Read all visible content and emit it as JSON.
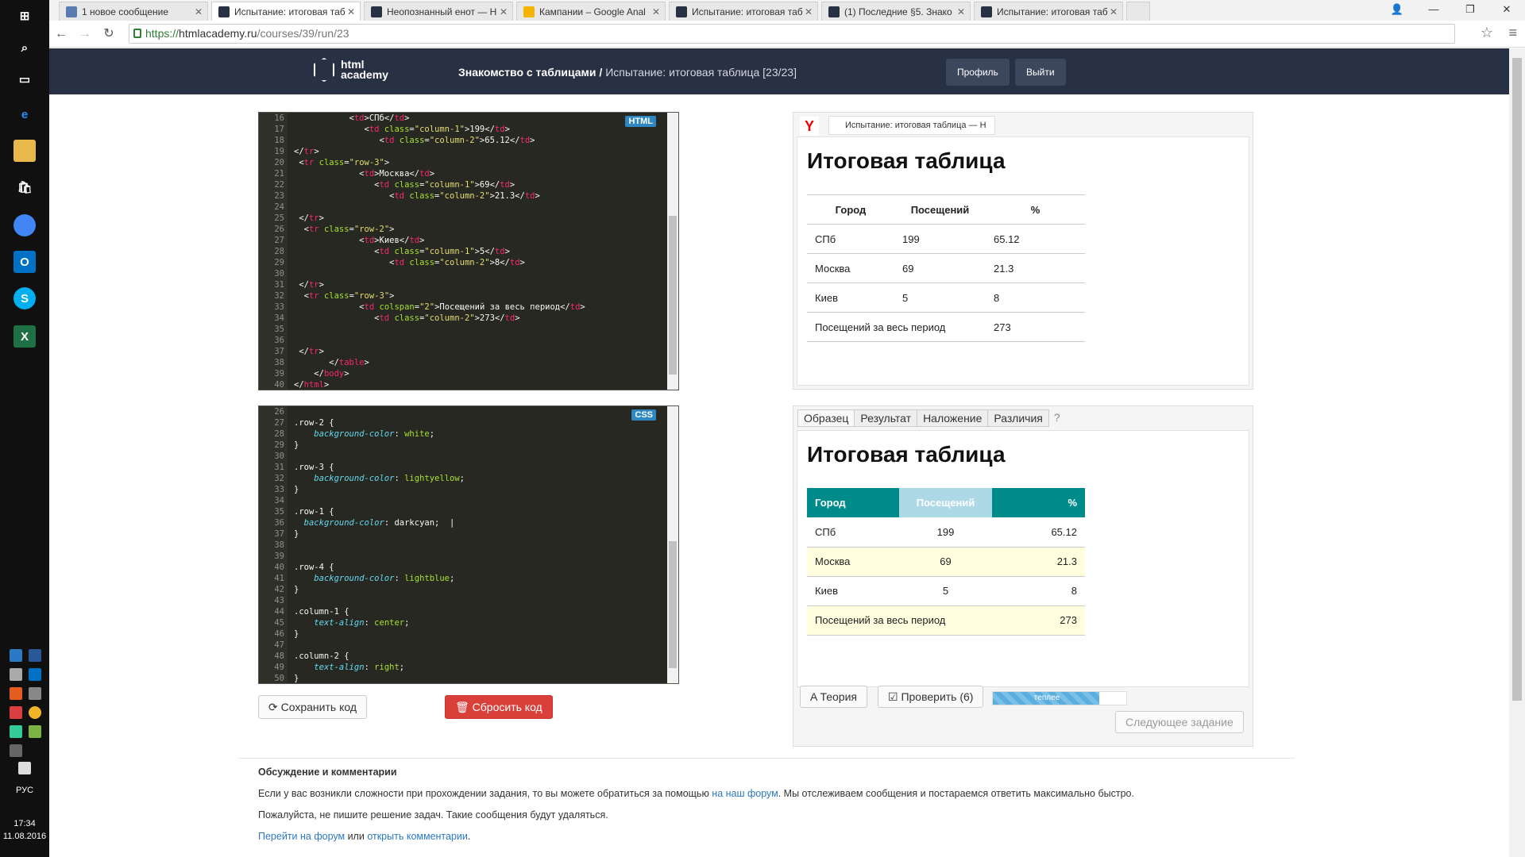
{
  "taskbar": {
    "language": "РУС",
    "time": "17:34",
    "date": "11.08.2016"
  },
  "tabs": [
    {
      "label": "1 новое сообщение",
      "icon_color": "#5b7bb3",
      "active": false
    },
    {
      "label": "Испытание: итоговая таб",
      "icon_color": "#283043",
      "active": true
    },
    {
      "label": "Неопознанный енот — H",
      "icon_color": "#283043",
      "active": false
    },
    {
      "label": "Кампании – Google Anal",
      "icon_color": "#f4b400",
      "active": false
    },
    {
      "label": "Испытание: итоговая таб",
      "icon_color": "#283043",
      "active": false
    },
    {
      "label": "(1) Последние §5. Знако",
      "icon_color": "#283043",
      "active": false
    },
    {
      "label": "Испытание: итоговая таб",
      "icon_color": "#283043",
      "active": false
    }
  ],
  "url": {
    "protocol": "https://",
    "host": "htmlacademy.ru",
    "path": "/courses/39/run/23"
  },
  "header": {
    "logo_line1": "html",
    "logo_line2": "academy",
    "course": "Знакомство с таблицами",
    "separator": " / ",
    "lesson": "Испытание: итоговая таблица",
    "progress": "[23/23]",
    "profile_btn": "Профиль",
    "logout_btn": "Выйти"
  },
  "html_editor": {
    "badge": "HTML",
    "line_numbers": [
      "16",
      "17",
      "18",
      "19",
      "20",
      "21",
      "22",
      "23",
      "24",
      "25",
      "26",
      "27",
      "28",
      "29",
      "30",
      "31",
      "32",
      "33",
      "34",
      "35",
      "36",
      "37",
      "38",
      "39",
      "40"
    ]
  },
  "css_editor": {
    "badge": "CSS",
    "line_numbers": [
      "26",
      "27",
      "28",
      "29",
      "30",
      "31",
      "32",
      "33",
      "34",
      "35",
      "36",
      "37",
      "38",
      "39",
      "40",
      "41",
      "42",
      "43",
      "44",
      "45",
      "46",
      "47",
      "48",
      "49",
      "50"
    ]
  },
  "buttons": {
    "save": "Сохранить код",
    "reset": "Сбросить код",
    "theory": "Теория",
    "check": "Проверить (6)",
    "next": "Следующее задание"
  },
  "result_preview": {
    "browser_tab": "Испытание: итоговая таблица — Н",
    "heading": "Итоговая таблица",
    "columns": [
      "Город",
      "Посещений",
      "%"
    ],
    "rows": [
      [
        "СПб",
        "199",
        "65.12"
      ],
      [
        "Москва",
        "69",
        "21.3"
      ],
      [
        "Киев",
        "5",
        "8"
      ]
    ],
    "total_label": "Посещений за весь период",
    "total_value": "273"
  },
  "sample_preview": {
    "tabs": [
      "Образец",
      "Результат",
      "Наложение",
      "Различия",
      "?"
    ],
    "heading": "Итоговая таблица",
    "columns": [
      "Город",
      "Посещений",
      "%"
    ],
    "rows": [
      [
        "СПб",
        "199",
        "65.12"
      ],
      [
        "Москва",
        "69",
        "21.3"
      ],
      [
        "Киев",
        "5",
        "8"
      ]
    ],
    "total_label": "Посещений за весь период",
    "total_value": "273",
    "colors": {
      "header": "#008b8b",
      "header_highlight": "#add8e6",
      "row_highlight": "#ffffe0"
    }
  },
  "hint": {
    "label": "теплее",
    "level": 0.8
  },
  "footer": {
    "title": "Обсуждение и комментарии",
    "p1_a": "Если у вас возникли сложности при прохождении задания, то вы можете обратиться за помощью ",
    "p1_link": "на наш форум",
    "p1_b": ". Мы отслеживаем сообщения и постараемся ответить максимально быстро.",
    "p2": "Пожалуйста, не пишите решение задач. Такие сообщения будут удаляться.",
    "link_forum": "Перейти на форум",
    "or": " или ",
    "link_comments": "открыть комментарии",
    "dot": "."
  }
}
